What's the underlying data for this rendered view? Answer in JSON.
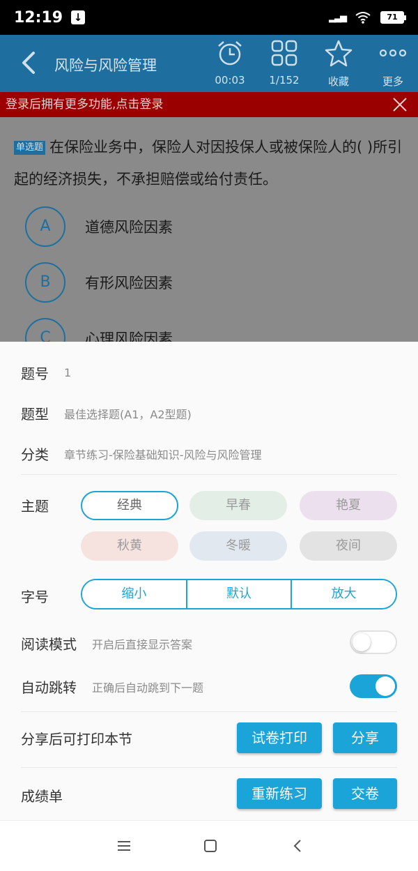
{
  "status": {
    "time": "12:19",
    "battery": "71"
  },
  "header": {
    "title": "风险与风险管理",
    "tools": [
      {
        "label": "00:03",
        "icon": "alarm-clock-icon"
      },
      {
        "label": "1/152",
        "icon": "grid-icon"
      },
      {
        "label": "收藏",
        "icon": "star-icon"
      },
      {
        "label": "更多",
        "icon": "more-icon"
      }
    ]
  },
  "login_banner": "登录后拥有更多功能,点击登录",
  "question": {
    "tag": "单选题",
    "text": "在保险业务中，保险人对因投保人或被保险人的(  )所引起的经济损失，不承担赔偿或给付责任。",
    "options": [
      {
        "letter": "A",
        "text": "道德风险因素"
      },
      {
        "letter": "B",
        "text": "有形风险因素"
      },
      {
        "letter": "C",
        "text": "心理风险因素"
      }
    ]
  },
  "sheet": {
    "number": {
      "key": "题号",
      "value": "1"
    },
    "type": {
      "key": "题型",
      "value": "最佳选择题(A1，A2型题)"
    },
    "category": {
      "key": "分类",
      "value": "章节练习-保险基础知识-风险与风险管理"
    },
    "theme": {
      "key": "主题",
      "options": [
        {
          "label": "经典",
          "color": "#ffffff",
          "active": true
        },
        {
          "label": "早春",
          "color": "#e3efe6"
        },
        {
          "label": "艳夏",
          "color": "#ede0ee"
        },
        {
          "label": "秋黄",
          "color": "#f6e3e0"
        },
        {
          "label": "冬暖",
          "color": "#e1e8f0"
        },
        {
          "label": "夜间",
          "color": "#e3e3e3"
        }
      ]
    },
    "font_size": {
      "key": "字号",
      "options": [
        "缩小",
        "默认",
        "放大"
      ]
    },
    "read_mode": {
      "key": "阅读模式",
      "desc": "开启后直接显示答案",
      "on": false
    },
    "auto_jump": {
      "key": "自动跳转",
      "desc": "正确后自动跳到下一题",
      "on": true
    },
    "share": {
      "key": "分享后可打印本节",
      "print_btn": "试卷打印",
      "share_btn": "分享"
    },
    "score": {
      "key": "成绩单",
      "redo_btn": "重新练习",
      "submit_btn": "交卷"
    }
  },
  "colors": {
    "accent": "#1aa4d8",
    "header": "#1e6fa0",
    "banner": "#9a0000"
  }
}
